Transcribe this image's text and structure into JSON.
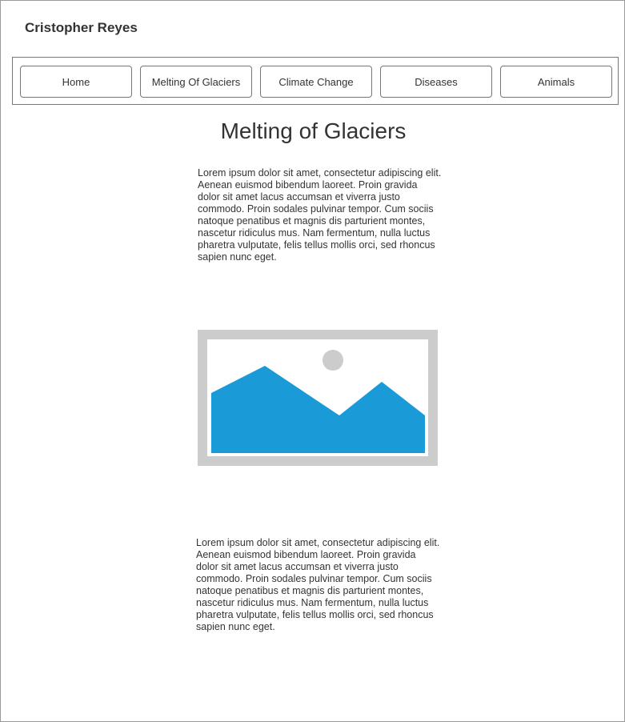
{
  "header": {
    "site_name": "Cristopher Reyes"
  },
  "nav": {
    "items": [
      {
        "label": "Home"
      },
      {
        "label": "Melting Of Glaciers"
      },
      {
        "label": "Climate Change"
      },
      {
        "label": "Diseases"
      },
      {
        "label": "Animals"
      }
    ]
  },
  "main": {
    "heading": "Melting of Glaciers",
    "paragraph_1": "Lorem ipsum dolor sit amet, consectetur adipiscing elit. Aenean euismod bibendum laoreet. Proin gravida dolor sit amet lacus accumsan et viverra justo commodo. Proin sodales pulvinar tempor. Cum sociis natoque penatibus et magnis dis parturient montes, nascetur ridiculus mus. Nam fermentum, nulla luctus pharetra vulputate, felis tellus mollis orci, sed rhoncus sapien nunc eget.",
    "image_icon": "image-placeholder-icon",
    "paragraph_2": "Lorem ipsum dolor sit amet, consectetur adipiscing elit. Aenean euismod bibendum laoreet. Proin gravida dolor sit amet lacus accumsan et viverra justo commodo. Proin sodales pulvinar tempor. Cum sociis natoque penatibus et magnis dis parturient montes, nascetur ridiculus mus. Nam fermentum, nulla luctus pharetra vulputate, felis tellus mollis orci, sed rhoncus sapien nunc eget."
  },
  "colors": {
    "image_frame": "#cccccc",
    "mountain": "#1a9ad6",
    "sun": "#cccccc",
    "border": "#777777",
    "text": "#333333"
  }
}
